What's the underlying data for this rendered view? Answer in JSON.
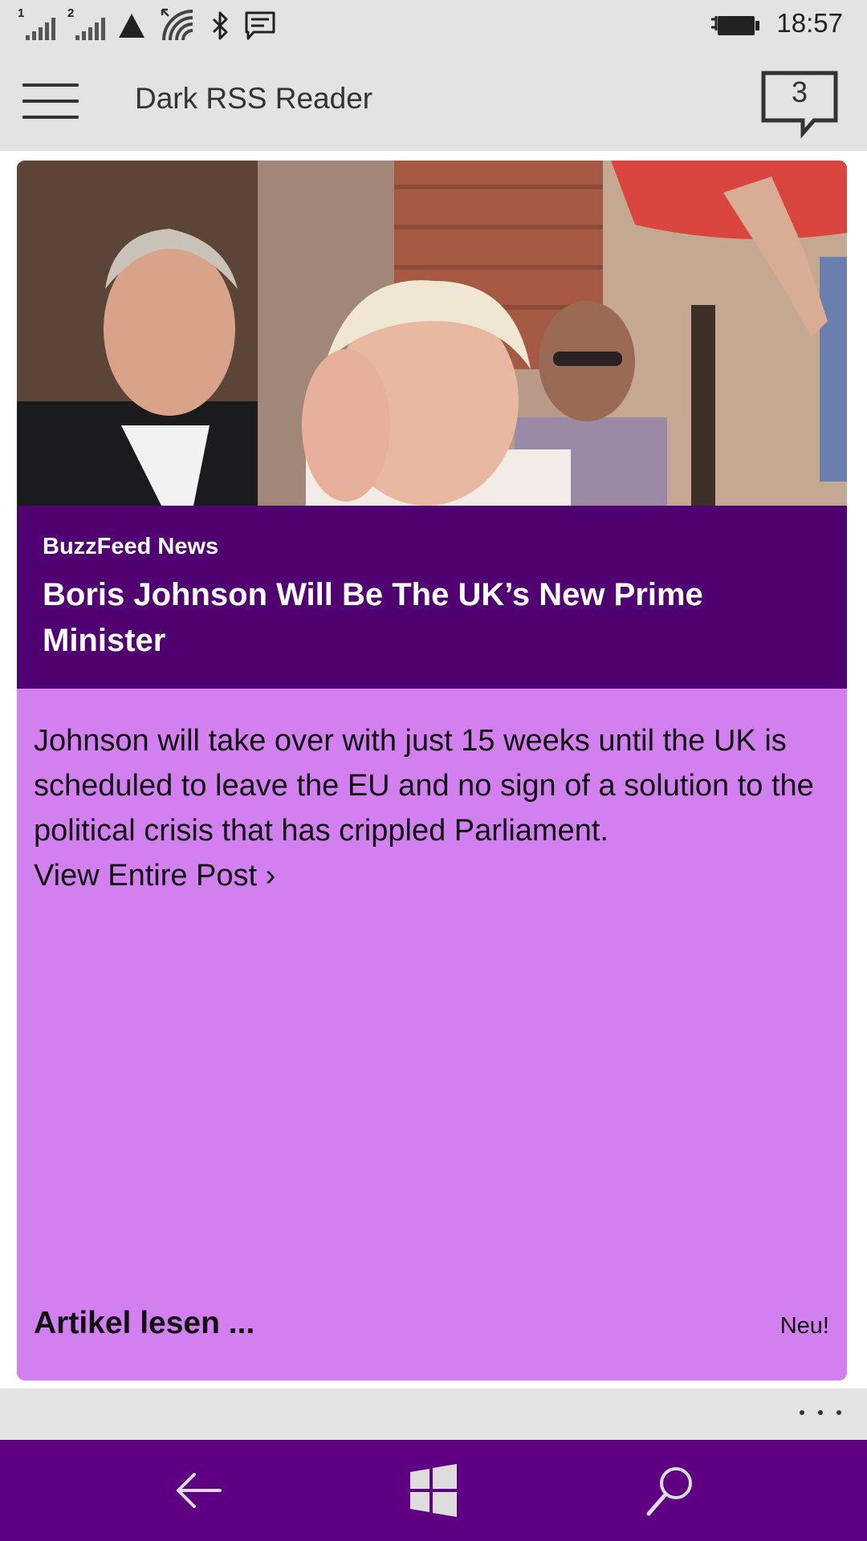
{
  "status_bar": {
    "sim1_label": "1",
    "sim2_label": "2",
    "time": "18:57",
    "icons": [
      "signal-sim1-icon",
      "signal-sim2-icon",
      "data-icon",
      "wifi-icon",
      "bluetooth-icon",
      "message-icon",
      "battery-charging-icon"
    ]
  },
  "header": {
    "title": "Dark RSS Reader",
    "notification_count": "3"
  },
  "card": {
    "source": "BuzzFeed News",
    "headline": "Boris Johnson Will Be The UK’s New Prime Minister",
    "summary": "Johnson will take over with just 15 weeks until the UK is scheduled to leave the EU and no sign of a solution to the political crisis that has crippled Parliament.",
    "view_link": "View Entire Post ›",
    "read_label": "Artikel lesen ...",
    "new_badge": "Neu!"
  },
  "nav": {
    "icons": [
      "back-arrow-icon",
      "windows-logo-icon",
      "search-icon"
    ]
  },
  "colors": {
    "header_bg": "#500070",
    "card_bg": "#d280f0",
    "nav_bg": "#5f0083",
    "chrome_bg": "#e3e3e3"
  }
}
